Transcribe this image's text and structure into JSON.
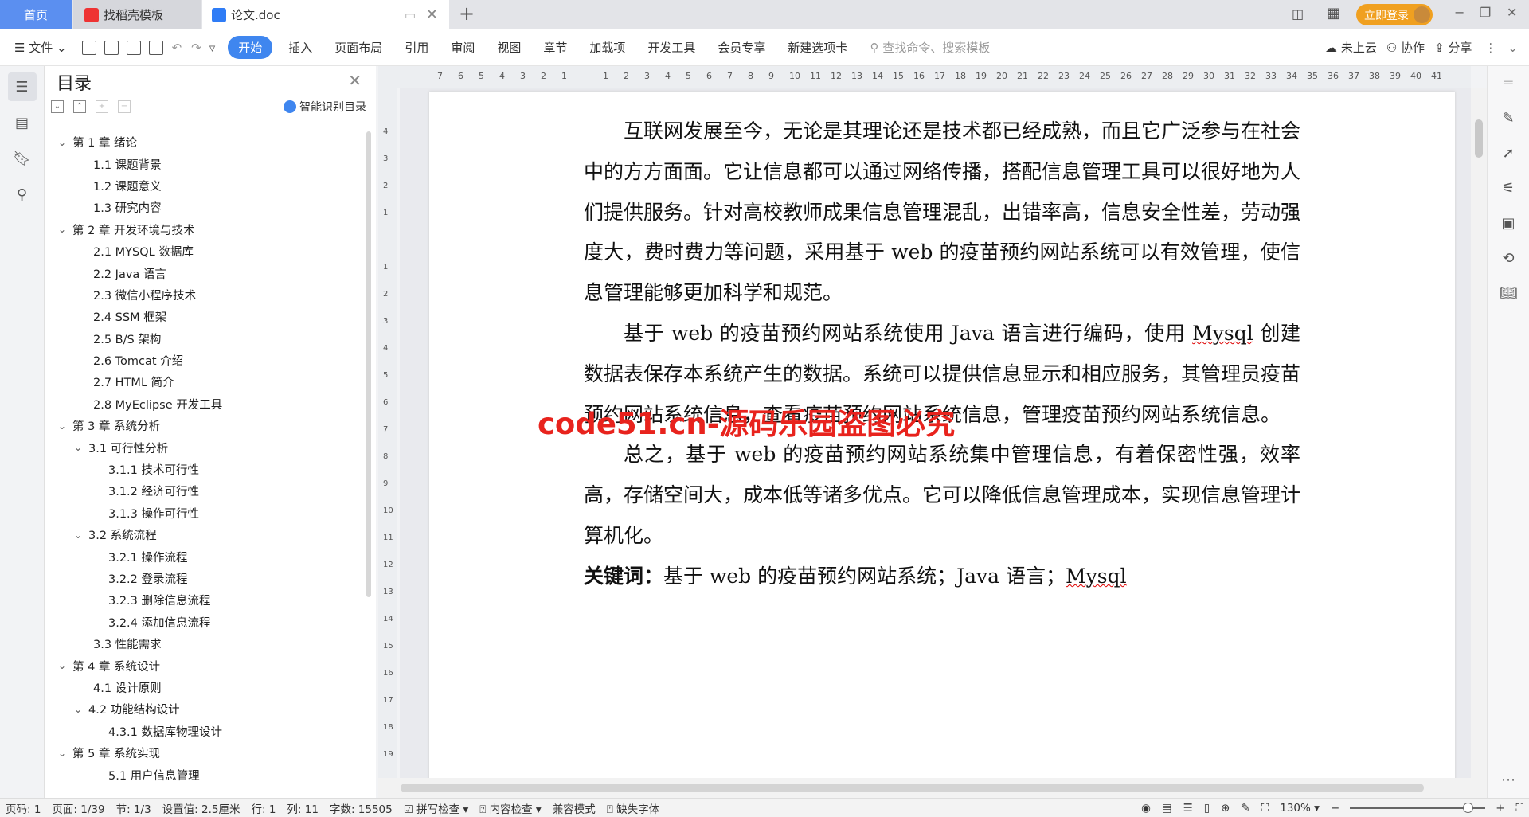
{
  "tabs": [
    {
      "label": "首页"
    },
    {
      "label": "找稻壳模板"
    },
    {
      "label": "论文.doc"
    }
  ],
  "login_label": "立即登录",
  "toolbar": {
    "file": "文件",
    "menus": [
      "开始",
      "插入",
      "页面布局",
      "引用",
      "审阅",
      "视图",
      "章节",
      "加载项",
      "开发工具",
      "会员专享",
      "新建选项卡"
    ],
    "search_placeholder": "查找命令、搜索模板",
    "cloud": "未上云",
    "collab": "协作",
    "share": "分享"
  },
  "toc": {
    "title": "目录",
    "smart": "智能识别目录",
    "items": [
      {
        "label": "第 1 章  绪论",
        "level": 1,
        "exp": true
      },
      {
        "label": "1.1  课题背景",
        "level": 2
      },
      {
        "label": "1.2  课题意义",
        "level": 2
      },
      {
        "label": "1.3  研究内容",
        "level": 2
      },
      {
        "label": "第 2 章  开发环境与技术",
        "level": 1,
        "exp": true
      },
      {
        "label": "2.1 MYSQL 数据库",
        "level": 2
      },
      {
        "label": "2.2 Java 语言",
        "level": 2
      },
      {
        "label": "2.3  微信小程序技术",
        "level": 2
      },
      {
        "label": "2.4 SSM 框架",
        "level": 2
      },
      {
        "label": "2.5 B/S 架构",
        "level": 2
      },
      {
        "label": "2.6 Tomcat  介绍",
        "level": 2
      },
      {
        "label": "2.7 HTML 简介",
        "level": 2
      },
      {
        "label": "2.8 MyEclipse 开发工具",
        "level": 2
      },
      {
        "label": "第 3 章  系统分析",
        "level": 1,
        "exp": true
      },
      {
        "label": "3.1  可行性分析",
        "level": 2,
        "exp": true
      },
      {
        "label": "3.1.1  技术可行性",
        "level": 3
      },
      {
        "label": "3.1.2  经济可行性",
        "level": 3
      },
      {
        "label": "3.1.3  操作可行性",
        "level": 3
      },
      {
        "label": "3.2  系统流程",
        "level": 2,
        "exp": true
      },
      {
        "label": "3.2.1  操作流程",
        "level": 3
      },
      {
        "label": "3.2.2  登录流程",
        "level": 3
      },
      {
        "label": "3.2.3  删除信息流程",
        "level": 3
      },
      {
        "label": "3.2.4  添加信息流程",
        "level": 3
      },
      {
        "label": "3.3  性能需求",
        "level": 2
      },
      {
        "label": "第 4 章  系统设计",
        "level": 1,
        "exp": true
      },
      {
        "label": "4.1  设计原则",
        "level": 2
      },
      {
        "label": "4.2  功能结构设计",
        "level": 2,
        "exp": true
      },
      {
        "label": "4.3.1  数据库物理设计",
        "level": 3
      },
      {
        "label": "第 5 章  系统实现",
        "level": 1,
        "exp": true
      },
      {
        "label": "5.1 用户信息管理",
        "level": 3
      }
    ]
  },
  "doc": {
    "paragraphs": [
      "互联网发展至今，无论是其理论还是技术都已经成熟，而且它广泛参与在社会中的方方面面。它让信息都可以通过网络传播，搭配信息管理工具可以很好地为人们提供服务。针对高校教师成果信息管理混乱，出错率高，信息安全性差，劳动强度大，费时费力等问题，采用基于 web 的疫苗预约网站系统可以有效管理，使信息管理能够更加科学和规范。",
      "基于 web 的疫苗预约网站系统使用 Java 语言进行编码，使用 Mysql 创建数据表保存本系统产生的数据。系统可以提供信息显示和相应服务，其管理员疫苗预约网站系统信息，查看疫苗预约网站系统信息，管理疫苗预约网站系统信息。",
      "总之，基于 web 的疫苗预约网站系统集中管理信息，有着保密性强，效率高，存储空间大，成本低等诸多优点。它可以降低信息管理成本，实现信息管理计算机化。"
    ],
    "keywords_label": "关键词：",
    "keywords": "基于 web 的疫苗预约网站系统；Java 语言；Mysql"
  },
  "watermark": "code51.cn-源码乐园盗图必究",
  "status": {
    "page_no": "页码: 1",
    "page": "页面: 1/39",
    "section": "节: 1/3",
    "setting": "设置值: 2.5厘米",
    "row": "行: 1",
    "col": "列: 11",
    "words": "字数: 15505",
    "spell": "拼写检查",
    "content": "内容检查",
    "compat": "兼容模式",
    "font_missing": "缺失字体",
    "zoom": "130%",
    "zoom_level": 130
  },
  "colors": {
    "accent": "#3f86ef",
    "login": "#f0a020",
    "watermark": "#e8231d"
  }
}
